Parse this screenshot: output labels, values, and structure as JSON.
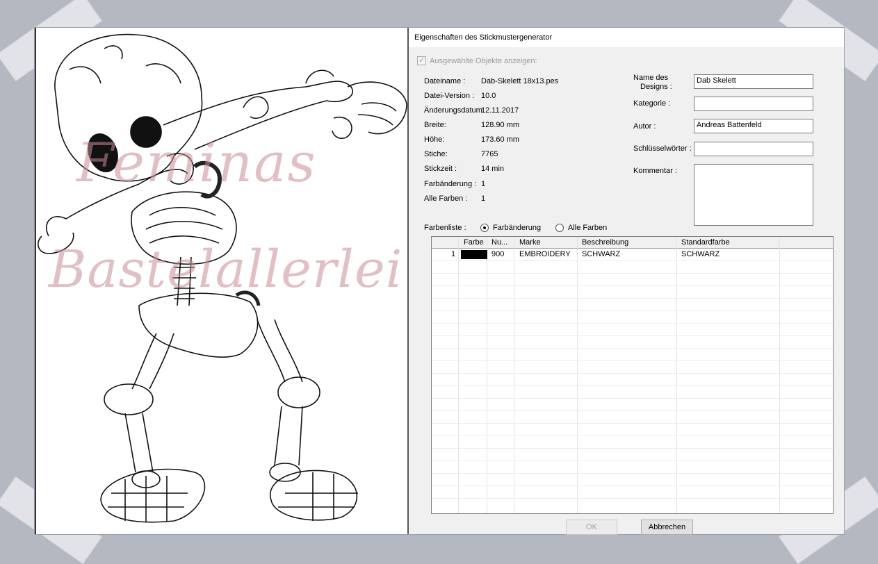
{
  "dialog": {
    "title": "Eigenschaften des Stickmustergenerator",
    "show_selected_label": "Ausgewählte Objekte anzeigen:",
    "info": {
      "filename_label": "Dateiname :",
      "filename": "Dab-Skelett 18x13.pes",
      "version_label": "Datei-Version :",
      "version": "10.0",
      "changed_label": "Änderungsdatum:",
      "changed": "12.11.2017",
      "width_label": "Breite:",
      "width": "128.90 mm",
      "height_label": "Höhe:",
      "height": "173.60 mm",
      "stitches_label": "Stiche:",
      "stitches": "7765",
      "time_label": "Stickzeit :",
      "time": "14 min",
      "colorchanges_label": "Farbänderung :",
      "colorchanges": "1",
      "allcolors_label": "Alle Farben :",
      "allcolors": "1"
    },
    "meta": {
      "design_name_label_1": "Name des",
      "design_name_label_2": "Designs :",
      "design_name": "Dab Skelett",
      "category_label": "Kategorie :",
      "category": "",
      "author_label": "Autor :",
      "author": "Andreas Battenfeld",
      "keywords_label": "Schlüsselwörter :",
      "keywords": "",
      "comment_label": "Kommentar :",
      "comment": ""
    },
    "colorlist_label": "Farbenliste :",
    "radio_colorchange": "Farbänderung",
    "radio_allcolors": "Alle Farben",
    "table": {
      "columns": [
        "Farbe",
        "Nu...",
        "Marke",
        "Beschreibung",
        "Standardfarbe"
      ],
      "rows": [
        {
          "index": "1",
          "swatch": "#000000",
          "number": "900",
          "brand": "EMBROIDERY",
          "description": "SCHWARZ",
          "standard": "SCHWARZ"
        }
      ]
    },
    "ok_label": "OK",
    "cancel_label": "Abbrechen"
  },
  "watermark": {
    "line1": "Feminas",
    "line2": "Bastelallerlei"
  },
  "colors": {
    "watermark": "#d4a7ad",
    "background": "#b4b8c0",
    "dialog_bg": "#f0f0f0"
  },
  "icons": [
    "checkbox-checked-icon",
    "radio-checked-icon",
    "radio-unchecked-icon"
  ]
}
